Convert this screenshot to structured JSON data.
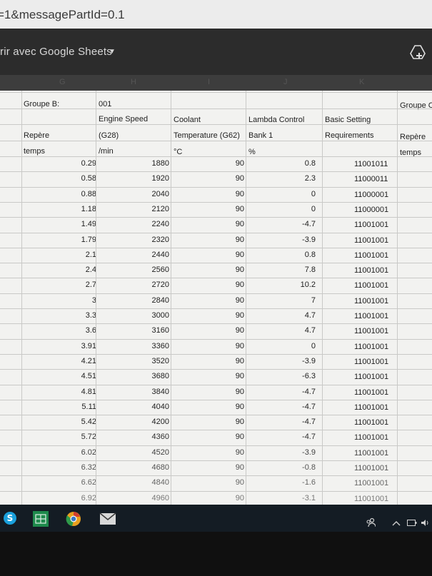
{
  "browser": {
    "url_fragment": "=1&messagePartId=0.1"
  },
  "app_bar": {
    "open_with_label": "rir avec Google Sheets"
  },
  "column_letters": [
    "G",
    "H",
    "I",
    "J",
    "K"
  ],
  "sheet": {
    "header_row1": {
      "a": "Groupe B:",
      "b": "001",
      "f": "Groupe C"
    },
    "header_row2": {
      "b": "Engine Speed",
      "c": "Coolant",
      "d": "Lambda Control",
      "e": "Basic Setting"
    },
    "header_row3": {
      "a": "Repère",
      "b": "(G28)",
      "c": "Temperature (G62)",
      "d": "Bank 1",
      "e": "Requirements",
      "f": "Repère"
    },
    "header_row4": {
      "a": "temps",
      "b": "/min",
      "c": "°C",
      "d": "%",
      "f": "temps"
    },
    "rows": [
      [
        "0.29",
        "1880",
        "90",
        "0.8",
        "11001011"
      ],
      [
        "0.58",
        "1920",
        "90",
        "2.3",
        "11000011"
      ],
      [
        "0.88",
        "2040",
        "90",
        "0",
        "11000001"
      ],
      [
        "1.18",
        "2120",
        "90",
        "0",
        "11000001"
      ],
      [
        "1.49",
        "2240",
        "90",
        "-4.7",
        "11001001"
      ],
      [
        "1.79",
        "2320",
        "90",
        "-3.9",
        "11001001"
      ],
      [
        "2.1",
        "2440",
        "90",
        "0.8",
        "11001001"
      ],
      [
        "2.4",
        "2560",
        "90",
        "7.8",
        "11001001"
      ],
      [
        "2.7",
        "2720",
        "90",
        "10.2",
        "11001001"
      ],
      [
        "3",
        "2840",
        "90",
        "7",
        "11001001"
      ],
      [
        "3.3",
        "3000",
        "90",
        "4.7",
        "11001001"
      ],
      [
        "3.6",
        "3160",
        "90",
        "4.7",
        "11001001"
      ],
      [
        "3.91",
        "3360",
        "90",
        "0",
        "11001001"
      ],
      [
        "4.21",
        "3520",
        "90",
        "-3.9",
        "11001001"
      ],
      [
        "4.51",
        "3680",
        "90",
        "-6.3",
        "11001001"
      ],
      [
        "4.81",
        "3840",
        "90",
        "-4.7",
        "11001001"
      ],
      [
        "5.11",
        "4040",
        "90",
        "-4.7",
        "11001001"
      ],
      [
        "5.42",
        "4200",
        "90",
        "-4.7",
        "11001001"
      ],
      [
        "5.72",
        "4360",
        "90",
        "-4.7",
        "11001001"
      ],
      [
        "6.02",
        "4520",
        "90",
        "-3.9",
        "11001001"
      ],
      [
        "6.32",
        "4680",
        "90",
        "-0.8",
        "11001001"
      ],
      [
        "6.62",
        "4840",
        "90",
        "-1.6",
        "11001001"
      ],
      [
        "6.92",
        "4960",
        "90",
        "-3.1",
        "11001001"
      ]
    ]
  },
  "taskbar": {
    "icons": [
      "skype-icon",
      "sheets-icon",
      "chrome-icon",
      "mail-icon",
      "people-icon",
      "chevron-up-icon",
      "battery-icon",
      "volume-icon"
    ]
  },
  "colors": {
    "urlbar": "#ececec",
    "appbar": "#2c2c2c",
    "sheet": "#f2f2f0",
    "taskbar": "#141c24",
    "skype": "#1aa0dc",
    "sheets": "#1e8a4c",
    "chrome": "#e8a020"
  }
}
